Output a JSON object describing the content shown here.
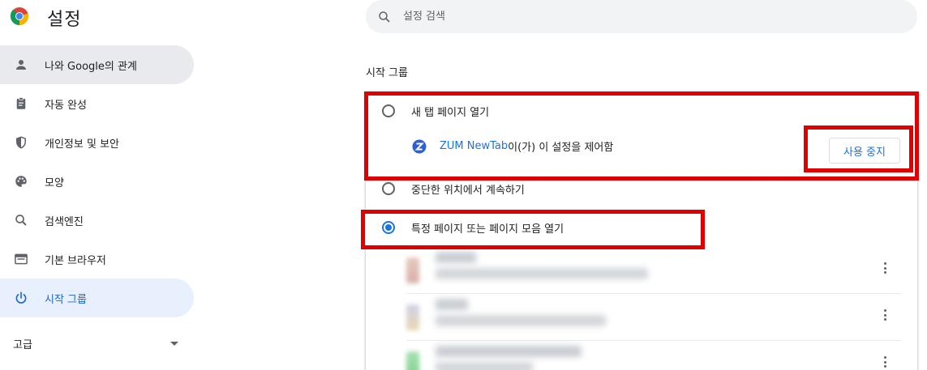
{
  "header": {
    "title": "설정",
    "search_placeholder": "설정 검색"
  },
  "sidebar": {
    "items": [
      {
        "label": "나와 Google의 관계",
        "icon": "person-icon"
      },
      {
        "label": "자동 완성",
        "icon": "clipboard-icon"
      },
      {
        "label": "개인정보 및 보안",
        "icon": "shield-icon"
      },
      {
        "label": "모양",
        "icon": "palette-icon"
      },
      {
        "label": "검색엔진",
        "icon": "search-icon"
      },
      {
        "label": "기본 브라우저",
        "icon": "browser-window-icon"
      },
      {
        "label": "시작 그룹",
        "icon": "power-icon"
      }
    ],
    "advanced_label": "고급"
  },
  "startup": {
    "section_title": "시작 그룹",
    "options": [
      {
        "label": "새 탭 페이지 열기",
        "checked": false
      },
      {
        "label": "중단한 위치에서 계속하기",
        "checked": false
      },
      {
        "label": "특정 페이지 또는 페이지 모음 열기",
        "checked": true
      }
    ],
    "extension": {
      "name": "ZUM NewTab",
      "suffix": "이(가) 이 설정을 제어함",
      "button_label": "사용 중지"
    }
  },
  "colors": {
    "accent": "#1a73e8",
    "annotation": "#e00000",
    "active_nav": "#e8f0fe"
  }
}
